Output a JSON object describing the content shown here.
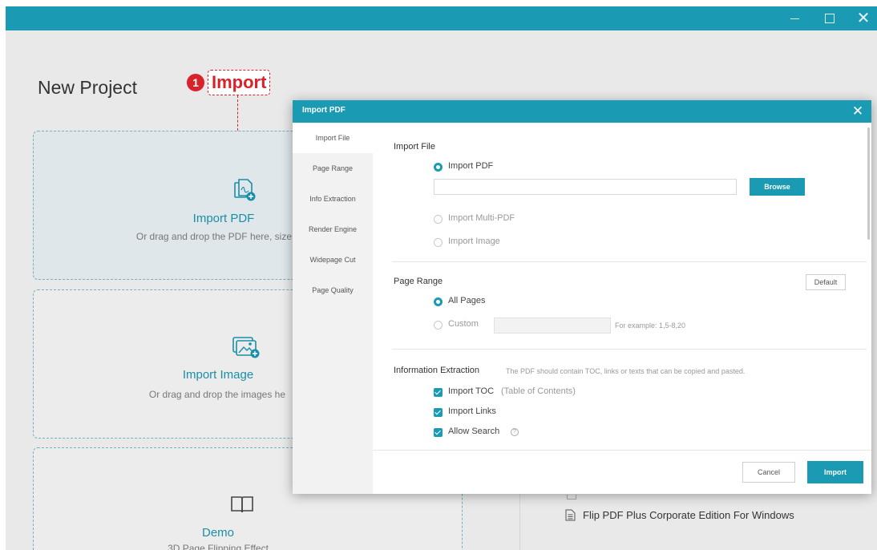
{
  "window": {
    "minimize_symbol": "—",
    "maximize_symbol": "",
    "close_symbol": "✕"
  },
  "page": {
    "title": "New Project"
  },
  "callout": {
    "number": "1",
    "label": "Import"
  },
  "cards": {
    "pdf": {
      "title": "Import PDF",
      "subtitle": "Or drag and drop the PDF here, size",
      "icon": "pdf-stack-icon"
    },
    "image": {
      "title": "Import Image",
      "subtitle": "Or drag and drop the images he",
      "icon": "image-stack-icon"
    },
    "demo": {
      "title": "Demo",
      "subtitle": "3D Page Flipping Effect",
      "icon": "book-icon"
    }
  },
  "recent": {
    "item_label": "Flip PDF Plus Corporate Edition For Windows",
    "icon": "document-icon"
  },
  "dialog": {
    "title": "Import PDF",
    "close_symbol": "✕",
    "nav": [
      "Import File",
      "Page Range",
      "Info Extraction",
      "Render Engine",
      "Widepage Cut",
      "Page Quality"
    ],
    "active_nav": "Import File",
    "import_file": {
      "heading": "Import File",
      "option_pdf": "Import PDF",
      "path_value": "",
      "browse_label": "Browse",
      "option_multi": "Import Multi-PDF",
      "option_image": "Import Image",
      "selected": "Import PDF"
    },
    "page_range": {
      "heading": "Page Range",
      "default_label": "Default",
      "option_all": "All Pages",
      "option_custom": "Custom",
      "custom_value": "",
      "example": "For example: 1,5-8,20",
      "selected": "All Pages"
    },
    "info_extraction": {
      "heading": "Information Extraction",
      "hint": "The PDF should contain TOC, links or texts that can be copied and pasted.",
      "toc_label": "Import TOC",
      "toc_hint": "(Table of Contents)",
      "links_label": "Import Links",
      "search_label": "Allow Search",
      "help_symbol": "?",
      "toc_checked": true,
      "links_checked": true,
      "search_checked": true
    },
    "footer": {
      "cancel_label": "Cancel",
      "import_label": "Import"
    },
    "accent_color": "#1a9bb3"
  },
  "colors": {
    "titlebar": "#1a9bb3",
    "callout": "#d9232a"
  }
}
